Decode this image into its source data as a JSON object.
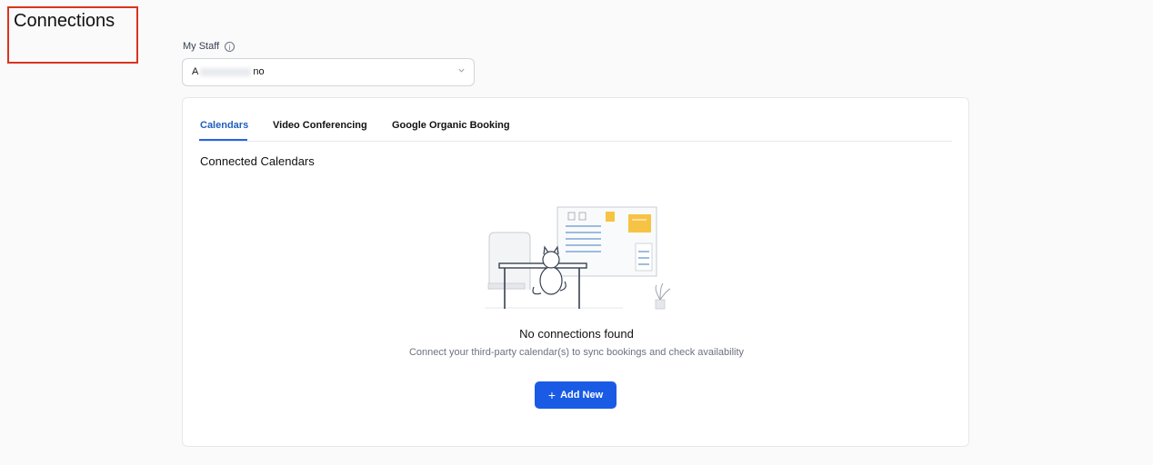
{
  "header": {
    "title": "Connections"
  },
  "staff": {
    "label": "My Staff",
    "info_icon": "info-icon",
    "selected_prefix": "A",
    "selected_suffix": "no"
  },
  "tabs": [
    {
      "label": "Calendars",
      "active": true
    },
    {
      "label": "Video Conferencing",
      "active": false
    },
    {
      "label": "Google Organic Booking",
      "active": false
    }
  ],
  "section": {
    "title": "Connected Calendars"
  },
  "empty_state": {
    "title": "No connections found",
    "subtitle": "Connect your third-party calendar(s) to sync bookings and check availability",
    "button_label": "Add New",
    "button_icon": "plus-icon"
  },
  "colors": {
    "accent": "#1a5be6",
    "annotation": "#d9341f",
    "active_tab": "#1f5fbf"
  }
}
